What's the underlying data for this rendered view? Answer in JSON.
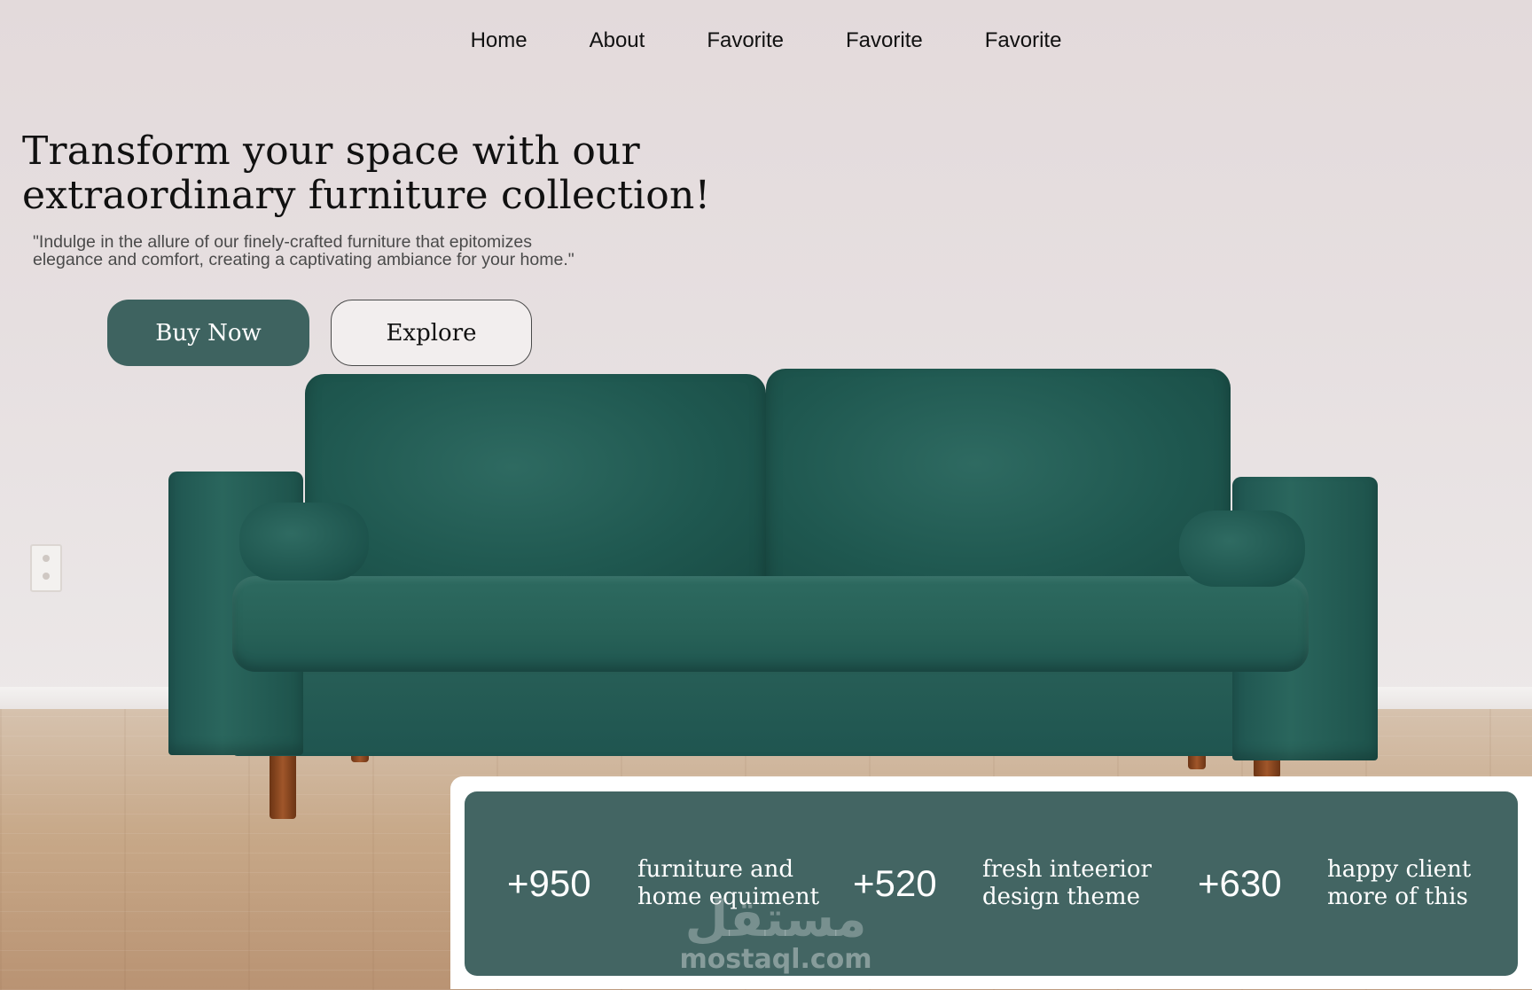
{
  "nav": {
    "items": [
      "Home",
      "About",
      "Favorite",
      "Favorite",
      "Favorite"
    ]
  },
  "hero": {
    "title_line1": "Transform your space with our",
    "title_line2": "extraordinary furniture collection!",
    "subtitle_line1": "\"Indulge in the allure of our finely-crafted furniture that epitomizes",
    "subtitle_line2": "elegance and comfort, creating a captivating ambiance for your home.\"",
    "buy_label": "Buy Now",
    "explore_label": "Explore"
  },
  "stats": [
    {
      "value": "+950",
      "label_line1": "furniture and",
      "label_line2": "home equiment"
    },
    {
      "value": "+520",
      "label_line1": "fresh inteerior",
      "label_line2": "design theme"
    },
    {
      "value": "+630",
      "label_line1": "happy client",
      "label_line2": "more of this"
    }
  ],
  "watermark": {
    "arabic": "مستقل",
    "latin": "mostaql.com"
  },
  "colors": {
    "accent": "#436563",
    "button_primary": "#3e6360",
    "sofa_green": "#2a665d",
    "wall": "#e4dcdc"
  },
  "icons": [
    "sofa-image",
    "wall-outlet"
  ]
}
